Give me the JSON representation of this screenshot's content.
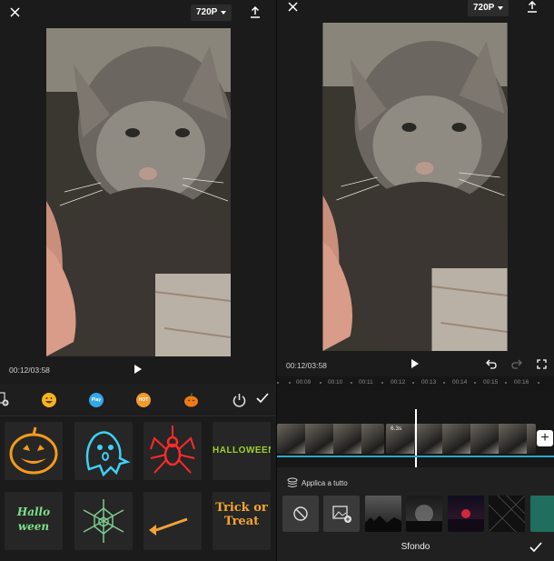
{
  "left": {
    "resolution": "720P",
    "time": "00:12/03:58",
    "categories": [
      {
        "name": "sticker-add-icon"
      },
      {
        "name": "emoji-category-icon"
      },
      {
        "name": "play-category-icon",
        "label": "Play"
      },
      {
        "name": "hot-category-icon",
        "label": "HOT"
      },
      {
        "name": "pumpkin-category-icon"
      },
      {
        "name": "power-category-icon"
      }
    ],
    "stickers": [
      {
        "name": "pumpkin-sticker"
      },
      {
        "name": "ghost-sticker"
      },
      {
        "name": "spider-sticker"
      },
      {
        "name": "halloween-text-sticker",
        "text": "HALLOWEEN"
      },
      {
        "name": "hallo-ween-text-sticker",
        "text": "Hallo ween"
      },
      {
        "name": "spiderweb-sticker"
      },
      {
        "name": "broom-sticker"
      },
      {
        "name": "trick-or-treat-sticker",
        "text": "Trick or Treat"
      }
    ]
  },
  "right": {
    "resolution": "720P",
    "time": "00:12/03:58",
    "ruler": [
      "00:09",
      "00:10",
      "00:11",
      "00:12",
      "00:13",
      "00:14",
      "00:15",
      "00:16"
    ],
    "clip_badge": "6.3s",
    "apply_all": "Applica a tutto",
    "title": "Sfondo",
    "colors": {
      "accent": "#2aa7c7"
    }
  }
}
